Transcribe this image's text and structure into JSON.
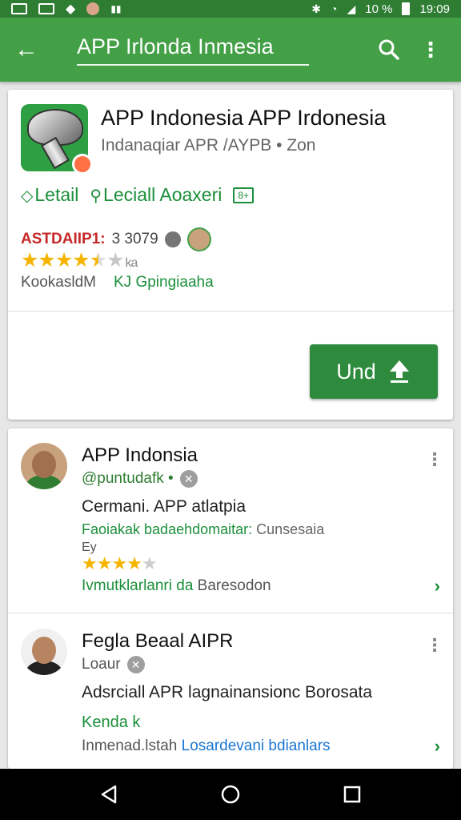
{
  "status_bar": {
    "battery": "10 %",
    "time": "19:09"
  },
  "app_bar": {
    "title": "APP Irlonda Inmesia"
  },
  "app_card": {
    "title": "APP Indonesia APP Irdonesia",
    "subtitle": "Indanaqiar APR /AYPB • Zon",
    "tag_1": "Letail",
    "tag_2": "Leciall Aoaxeri",
    "age_badge": "8+",
    "rating_text": "ASTDAIIP1:",
    "rating_count": "3 3079",
    "stars_suffix": "ka",
    "meta_left": "KookasldM",
    "meta_right": "KJ Gpingiaaha",
    "install_label": "Und",
    "rating_stars": 4.5
  },
  "reviews": [
    {
      "name": "APP Indonsia",
      "handle": "@puntudafk •",
      "title_line": "Cermani. APP atlatpia",
      "green_line": "Faoiakak badaehdomaitar:",
      "green_line_gray": "Cunsesaia",
      "small_line": "Ey",
      "stars": 4.5,
      "footer_green": "Ivmutklarlanri da",
      "footer_gray": "Baresodon"
    },
    {
      "name": "Fegla Beaal AIPR",
      "handle": "Loaur",
      "title_line": "Adsrciall APR lagnainansionc Borosata",
      "green_line": "Kenda k",
      "footer_gray": "Inmenad.lstah",
      "footer_blue": "Losardevani bdianlars"
    }
  ],
  "colors": {
    "app_bar": "#43a047",
    "status_bar": "#2e7d32",
    "accent": "#1b8f3a",
    "install": "#2e8b3d",
    "star": "#f4b400"
  }
}
